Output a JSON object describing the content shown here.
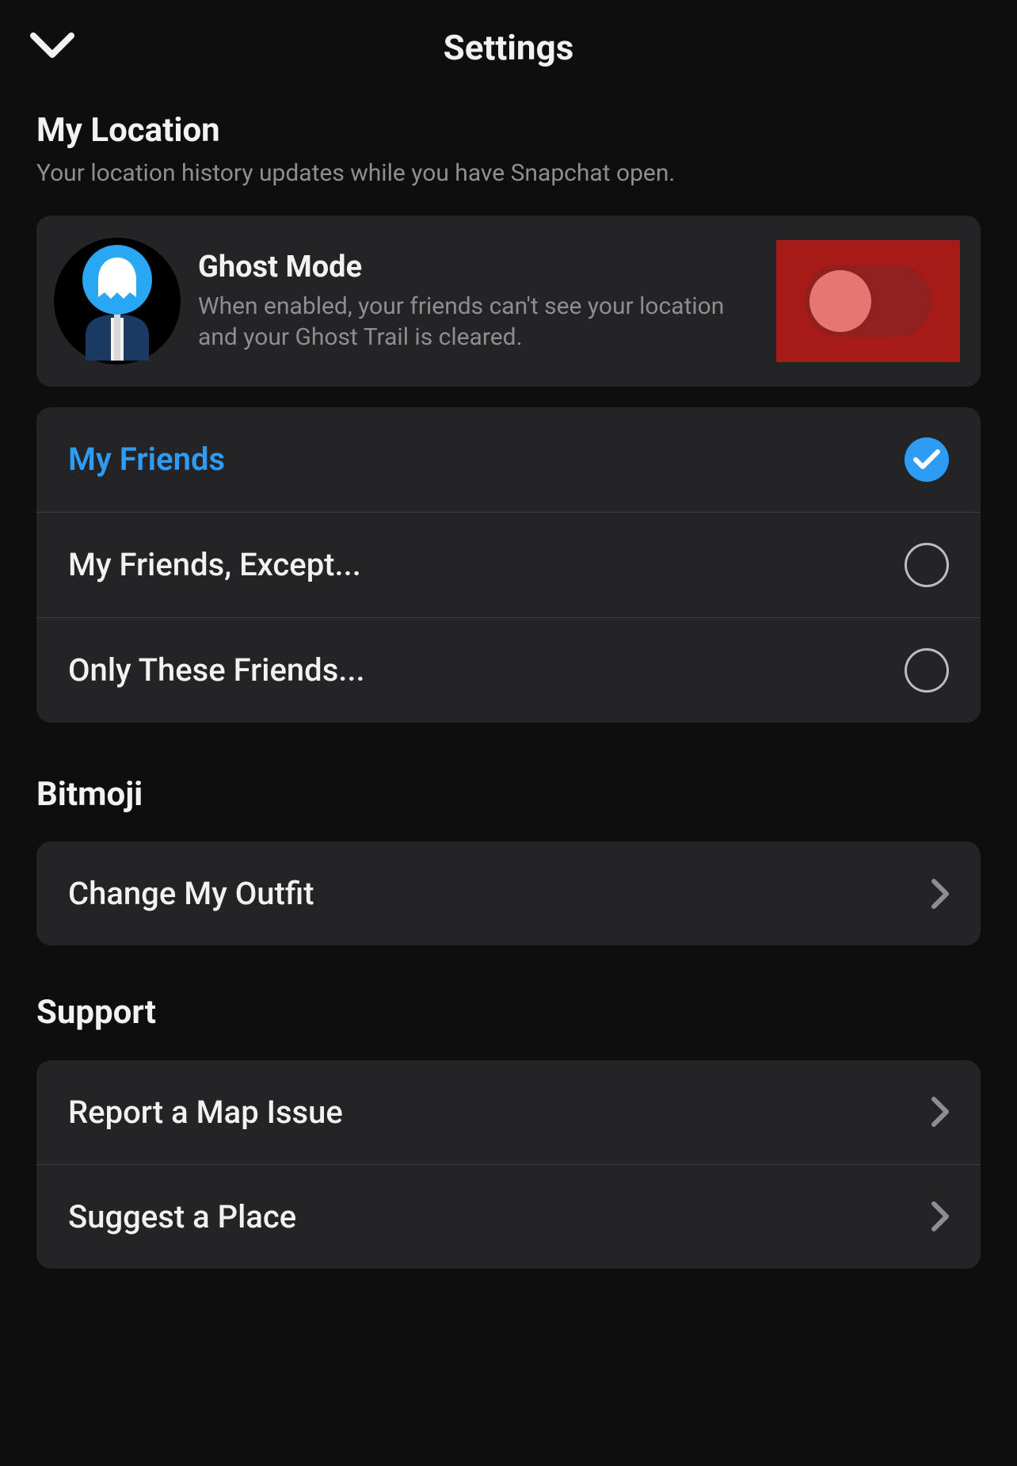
{
  "header": {
    "title": "Settings"
  },
  "location": {
    "title": "My Location",
    "subtitle": "Your location history updates while you have Snapchat open.",
    "ghost_mode": {
      "title": "Ghost Mode",
      "description": "When enabled, your friends can't see your location and your Ghost Trail is cleared.",
      "enabled": false
    },
    "visibility_options": [
      {
        "label": "My Friends",
        "selected": true
      },
      {
        "label": "My Friends, Except...",
        "selected": false
      },
      {
        "label": "Only These Friends...",
        "selected": false
      }
    ]
  },
  "bitmoji": {
    "title": "Bitmoji",
    "items": [
      {
        "label": "Change My Outfit"
      }
    ]
  },
  "support": {
    "title": "Support",
    "items": [
      {
        "label": "Report a Map Issue"
      },
      {
        "label": "Suggest a Place"
      }
    ]
  }
}
